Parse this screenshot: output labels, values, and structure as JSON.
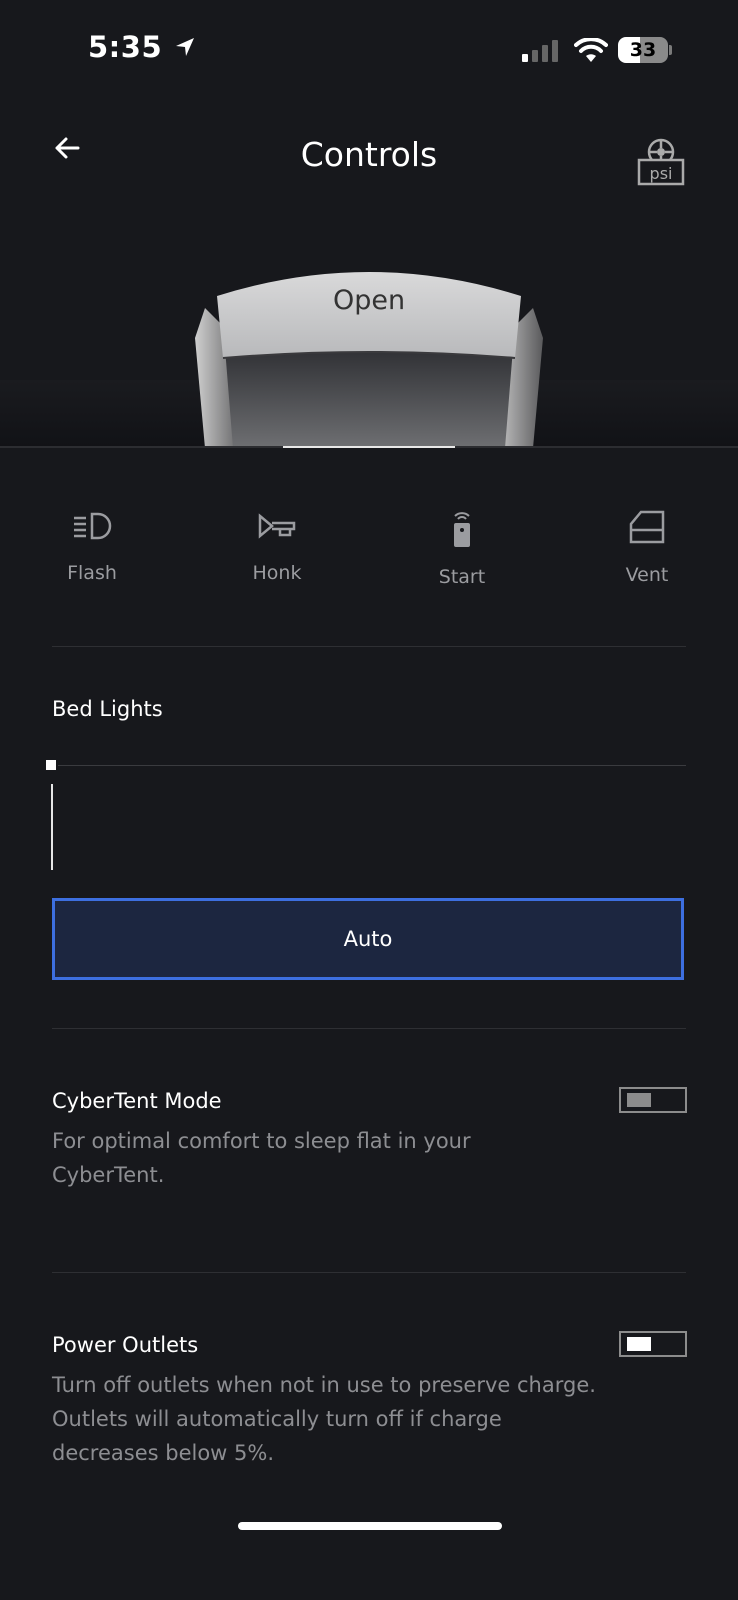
{
  "status_bar": {
    "time": "5:35",
    "battery": "33"
  },
  "header": {
    "title": "Controls"
  },
  "hero": {
    "frunk_status": "Open"
  },
  "quick_controls": [
    {
      "label": "Flash",
      "icon": "headlight-icon"
    },
    {
      "label": "Honk",
      "icon": "horn-icon"
    },
    {
      "label": "Start",
      "icon": "key-fob-icon"
    },
    {
      "label": "Vent",
      "icon": "window-vent-icon"
    }
  ],
  "bed_lights": {
    "title": "Bed Lights",
    "level": 0,
    "mode_button": "Auto"
  },
  "cybertent": {
    "title": "CyberTent Mode",
    "description": "For optimal comfort to sleep flat in your CyberTent.",
    "enabled": false
  },
  "power_outlets": {
    "title": "Power Outlets",
    "description": "Turn off outlets when not in use to preserve charge. Outlets will automatically turn off if charge decreases below 5%.",
    "enabled": true
  },
  "colors": {
    "background": "#17181c",
    "accent": "#3d6fe0",
    "accent_fill": "#1c2640",
    "muted_text": "#9b9ca0"
  }
}
